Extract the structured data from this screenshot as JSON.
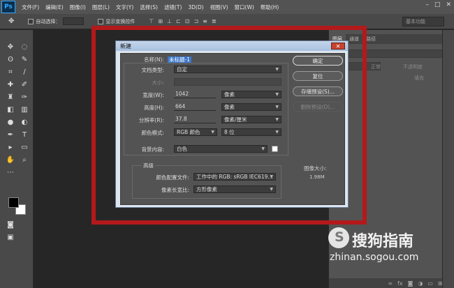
{
  "app": {
    "logo": "Ps"
  },
  "menubar": {
    "items": [
      "文件(F)",
      "编辑(E)",
      "图像(I)",
      "图层(L)",
      "文字(Y)",
      "选择(S)",
      "滤镜(T)",
      "3D(D)",
      "视图(V)",
      "窗口(W)",
      "帮助(H)"
    ],
    "window_controls": [
      "–",
      "□",
      "✕"
    ]
  },
  "optionsbar": {
    "auto_select_label": "自动选择：",
    "show_transform_label": "显示变换控件",
    "workspace_label": "基本功能"
  },
  "panels": {
    "tabs": [
      "图层",
      "通道",
      "路径"
    ],
    "mode_label": "正常",
    "opacity_label": "不透明度",
    "fill_label": "填充"
  },
  "dialog": {
    "title": "新建",
    "name_label": "名称(N):",
    "name_value": "未标题-1",
    "doc_type_label": "文档类型:",
    "doc_type_value": "自定",
    "size_label": "大小:",
    "width_label": "宽度(W):",
    "width_value": "1042",
    "width_unit": "像素",
    "height_label": "高度(H):",
    "height_value": "664",
    "height_unit": "像素",
    "resolution_label": "分辨率(R):",
    "resolution_value": "37.8",
    "resolution_unit": "像素/厘米",
    "color_mode_label": "颜色模式:",
    "color_mode_value": "RGB 颜色",
    "bit_depth_value": "8 位",
    "bg_label": "背景内容:",
    "bg_value": "白色",
    "advanced_label": "高级",
    "color_profile_label": "颜色配置文件:",
    "color_profile_value": "工作中的 RGB: sRGB IEC619...",
    "pixel_aspect_label": "像素长宽比:",
    "pixel_aspect_value": "方形像素",
    "ok_button": "确定",
    "reset_button": "复位",
    "save_preset_button": "存储预设(S)...",
    "delete_preset_button": "删除预设(D)...",
    "image_size_label": "图像大小:",
    "image_size_value": "1.98M"
  },
  "watermark": {
    "brand": "搜狗指南",
    "url": "zhinan.sogou.com"
  }
}
